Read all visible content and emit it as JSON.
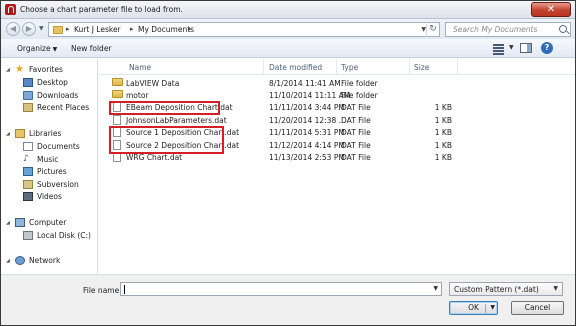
{
  "window": {
    "title": "Choose a chart parameter file to load from.",
    "close_label": "✕"
  },
  "address": {
    "crumbs": [
      "Kurt J Lesker",
      "My Documents"
    ],
    "search_placeholder": "Search My Documents"
  },
  "toolbar": {
    "organize_label": "Organize",
    "new_folder_label": "New folder"
  },
  "nav": {
    "favorites": "Favorites",
    "favorites_items": [
      "Desktop",
      "Downloads",
      "Recent Places"
    ],
    "libraries": "Libraries",
    "libraries_items": [
      "Documents",
      "Music",
      "Pictures",
      "Subversion",
      "Videos"
    ],
    "computer": "Computer",
    "computer_items": [
      "Local Disk (C:)"
    ],
    "network": "Network"
  },
  "columns": {
    "name": "Name",
    "date": "Date modified",
    "type": "Type",
    "size": "Size"
  },
  "files": [
    {
      "name": "LabVIEW Data",
      "date": "8/1/2014 11:41 AM",
      "type": "File folder",
      "size": "",
      "kind": "folder",
      "highlighted": false
    },
    {
      "name": "motor",
      "date": "11/10/2014 11:11 AM",
      "type": "File folder",
      "size": "",
      "kind": "folder",
      "highlighted": false
    },
    {
      "name": "EBeam Deposition Chart.dat",
      "date": "11/11/2014 3:44 PM",
      "type": "DAT File",
      "size": "1 KB",
      "kind": "file",
      "highlighted": true
    },
    {
      "name": "JohnsonLabParameters.dat",
      "date": "11/20/2014 12:38 ...",
      "type": "DAT File",
      "size": "1 KB",
      "kind": "file",
      "highlighted": false
    },
    {
      "name": "Source 1 Deposition Chart.dat",
      "date": "11/11/2014 5:31 PM",
      "type": "DAT File",
      "size": "1 KB",
      "kind": "file",
      "highlighted": true
    },
    {
      "name": "Source 2 Deposition Chart.dat",
      "date": "11/12/2014 4:14 PM",
      "type": "DAT File",
      "size": "1 KB",
      "kind": "file",
      "highlighted": true
    },
    {
      "name": "WRG Chart.dat",
      "date": "11/13/2014 2:53 PM",
      "type": "DAT File",
      "size": "1 KB",
      "kind": "file",
      "highlighted": false
    }
  ],
  "bottom": {
    "file_name_label": "File name:",
    "file_name_value": "",
    "file_type_value": "Custom Pattern (*.dat)",
    "ok_label": "OK",
    "cancel_label": "Cancel"
  },
  "colors": {
    "highlight_box": "#d31f2a",
    "title_bar": "#dde3ea"
  }
}
